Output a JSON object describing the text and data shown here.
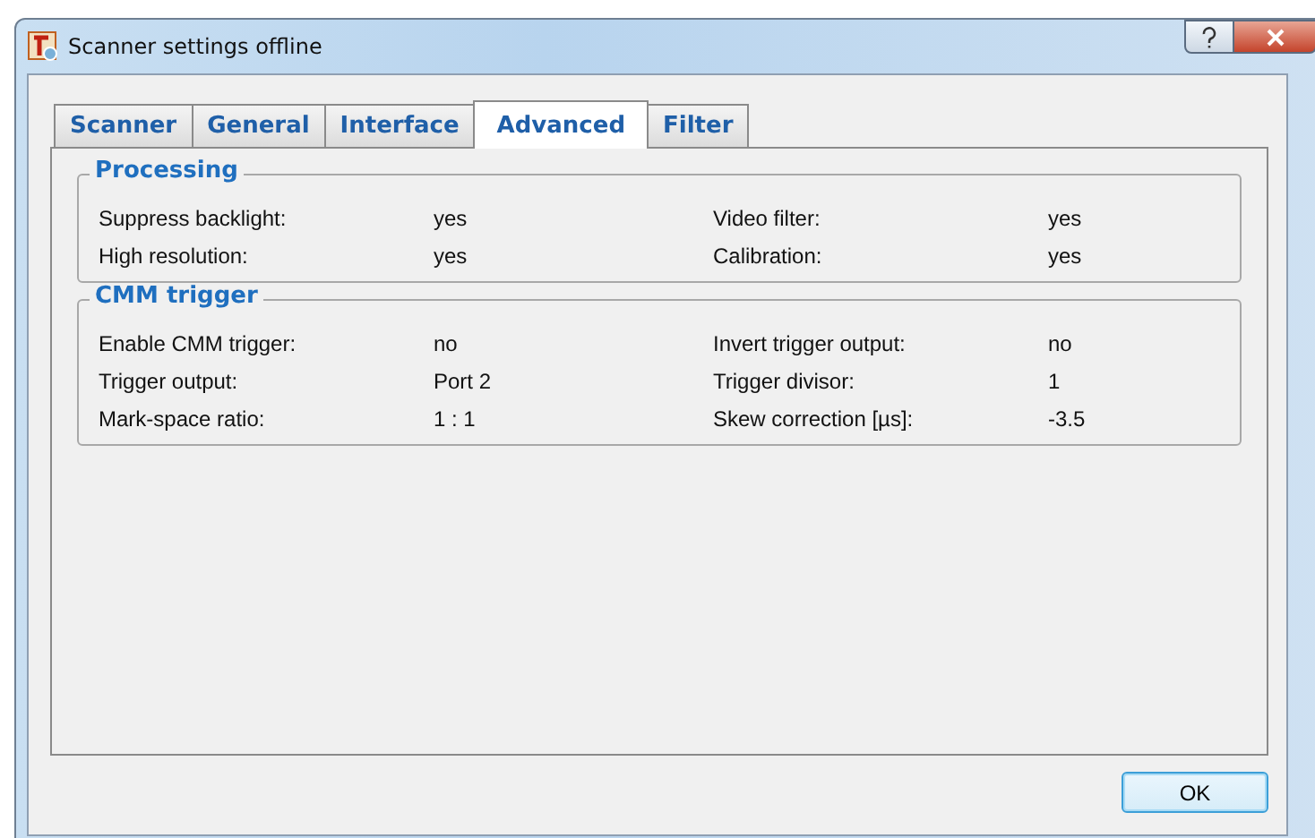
{
  "window": {
    "title": "Scanner settings offline"
  },
  "tabs": [
    {
      "label": "Scanner",
      "selected": false
    },
    {
      "label": "General",
      "selected": false
    },
    {
      "label": "Interface",
      "selected": false
    },
    {
      "label": "Advanced",
      "selected": true
    },
    {
      "label": "Filter",
      "selected": false
    }
  ],
  "groups": [
    {
      "title": "Processing",
      "rows": [
        {
          "label": "Suppress backlight:",
          "value": "yes",
          "label_2": "Video filter:",
          "value_2": "yes"
        },
        {
          "label": "High resolution:",
          "value": "yes",
          "label_2": "Calibration:",
          "value_2": "yes"
        }
      ]
    },
    {
      "title": "CMM trigger",
      "rows": [
        {
          "label": "Enable CMM trigger:",
          "value": "no",
          "label_2": "Invert trigger output:",
          "value_2": "no"
        },
        {
          "label": "Trigger output:",
          "value": "Port 2",
          "label_2": "Trigger divisor:",
          "value_2": "1"
        },
        {
          "label": "Mark-space ratio:",
          "value": "1 : 1",
          "label_2": "Skew correction [µs]:",
          "value_2": "-3.5"
        }
      ]
    }
  ],
  "buttons": [
    "OK"
  ]
}
